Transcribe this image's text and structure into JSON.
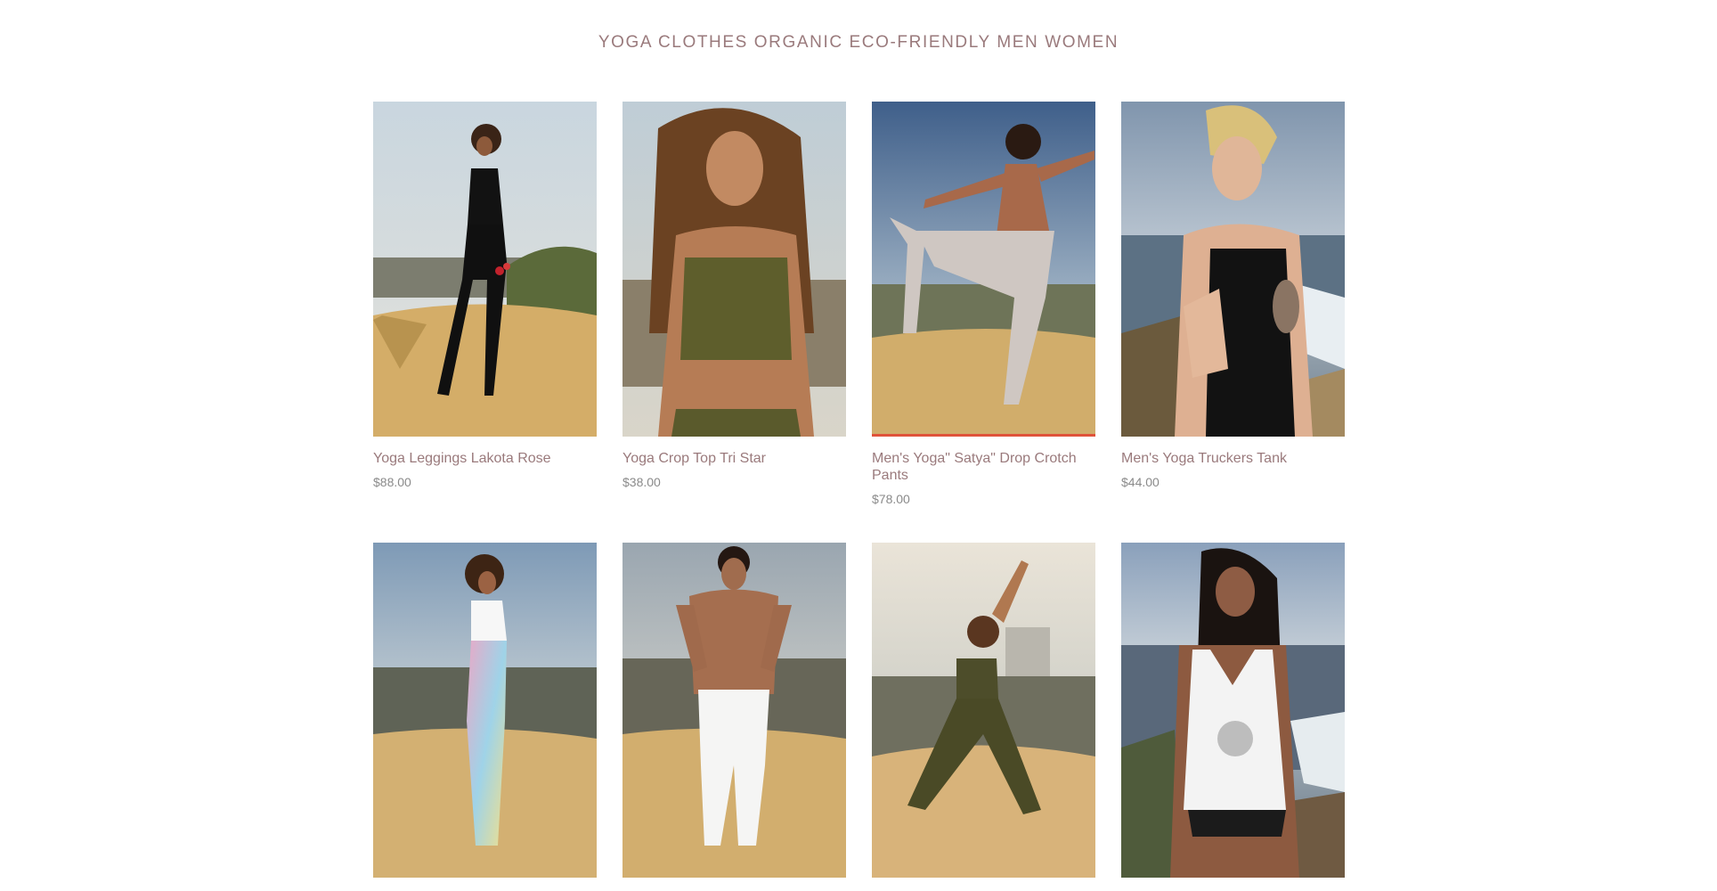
{
  "page": {
    "title": "YOGA CLOTHES ORGANIC ECO-FRIENDLY MEN WOMEN"
  },
  "products": [
    {
      "name": "Yoga Leggings Lakota Rose",
      "price": "$88.00"
    },
    {
      "name": "Yoga Crop Top Tri Star",
      "price": "$38.00"
    },
    {
      "name": "Men's Yoga\" Satya\" Drop Crotch Pants",
      "price": "$78.00"
    },
    {
      "name": "Men's Yoga Truckers Tank",
      "price": "$44.00"
    },
    {
      "name": "",
      "price": ""
    },
    {
      "name": "",
      "price": ""
    },
    {
      "name": "",
      "price": ""
    },
    {
      "name": "",
      "price": ""
    }
  ],
  "colors": {
    "title": "#9a7a7c",
    "price": "#8a8a8a",
    "highlight": "#e0533a"
  }
}
